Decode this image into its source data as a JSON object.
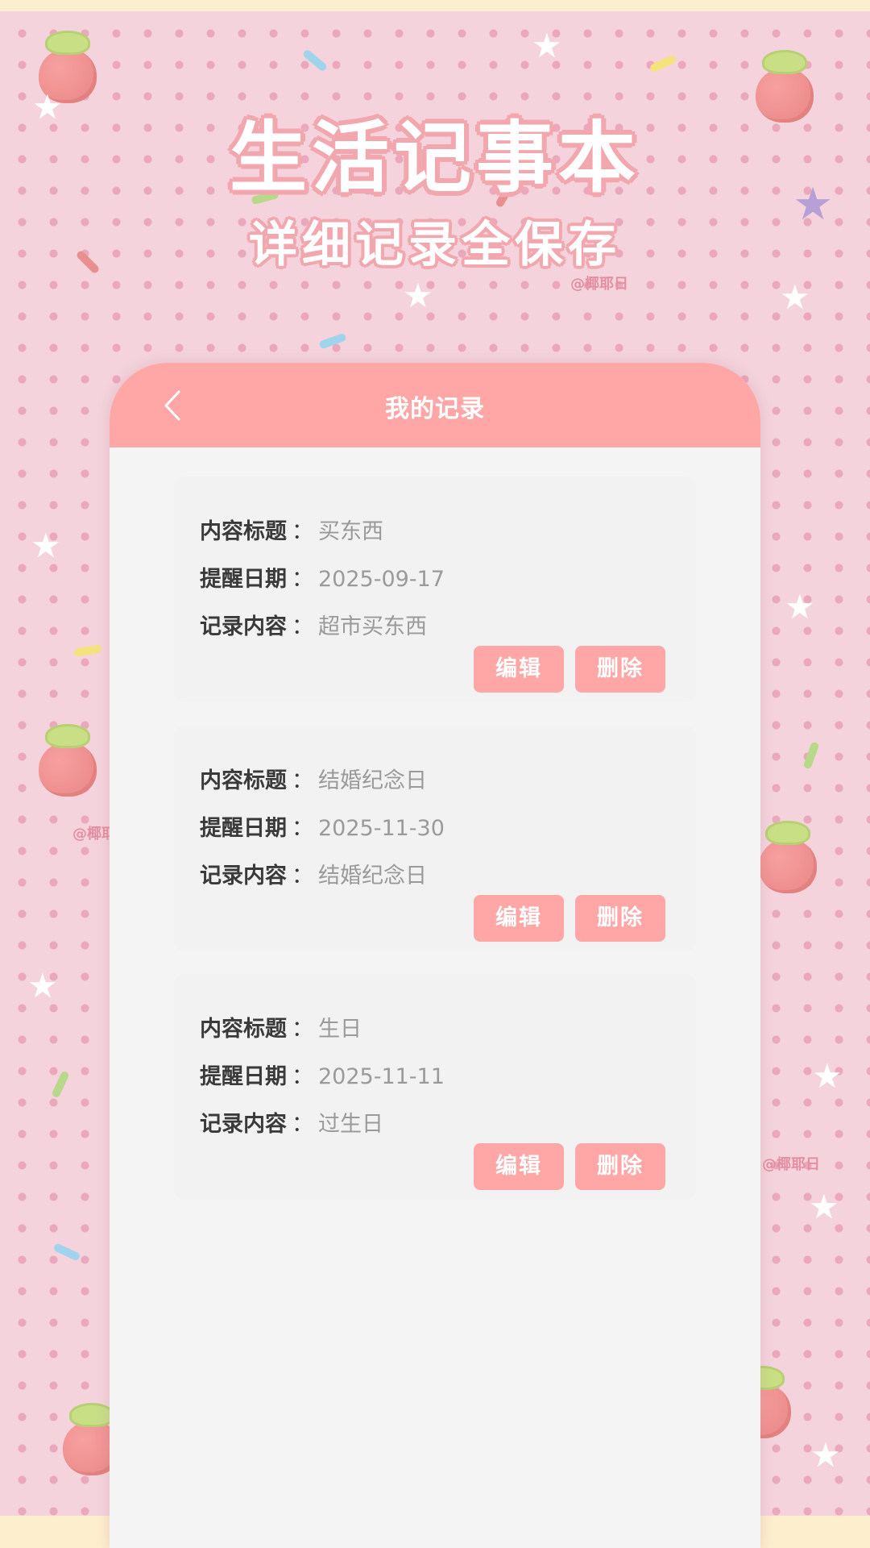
{
  "poster": {
    "title": "生活记事本",
    "subtitle": "详细记录全保存",
    "watermark": "@椰耶日"
  },
  "header": {
    "title": "我的记录",
    "back_icon": "chevron-left-icon"
  },
  "labels": {
    "title": "内容标题",
    "date": "提醒日期",
    "content": "记录内容",
    "separator": "：",
    "edit": "编辑",
    "delete": "删除"
  },
  "records": [
    {
      "title": "买东西",
      "date": "2025-09-17",
      "content": "超市买东西"
    },
    {
      "title": "结婚纪念日",
      "date": "2025-11-30",
      "content": "结婚纪念日"
    },
    {
      "title": "生日",
      "date": "2025-11-11",
      "content": "过生日"
    }
  ],
  "colors": {
    "accent": "#ffa6a6",
    "background": "#f4d3dc",
    "card": "#f2f2f2",
    "label_text": "#3a3a3a",
    "value_text": "#9a9a9a"
  }
}
